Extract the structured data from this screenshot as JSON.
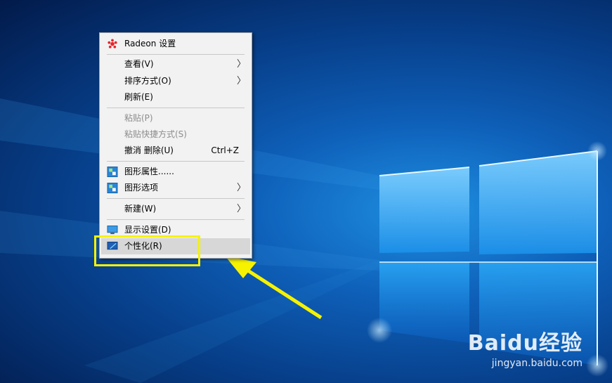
{
  "context_menu": {
    "items": [
      {
        "label": "Radeon 设置",
        "icon": "radeon-icon"
      },
      {
        "label": "查看(V)",
        "submenu": true
      },
      {
        "label": "排序方式(O)",
        "submenu": true
      },
      {
        "label": "刷新(E)"
      },
      {
        "label": "粘贴(P)",
        "disabled": true
      },
      {
        "label": "粘贴快捷方式(S)",
        "disabled": true
      },
      {
        "label": "撤消 删除(U)",
        "shortcut": "Ctrl+Z"
      },
      {
        "label": "图形属性......",
        "icon": "graphics-icon"
      },
      {
        "label": "图形选项",
        "icon": "graphics-icon",
        "submenu": true
      },
      {
        "label": "新建(W)",
        "submenu": true
      },
      {
        "label": "显示设置(D)",
        "icon": "display-icon"
      },
      {
        "label": "个性化(R)",
        "icon": "personalize-icon",
        "hovered": true
      }
    ]
  },
  "annotation": {
    "highlight_color": "#f6f200",
    "arrow_color": "#f6f200"
  },
  "watermark": {
    "brand": "Baidu经验",
    "url": "jingyan.baidu.com"
  },
  "colors": {
    "desktop_blue": "#0e5fb8",
    "menu_bg": "#f2f2f2",
    "hover_bg": "#d7d7d7"
  }
}
